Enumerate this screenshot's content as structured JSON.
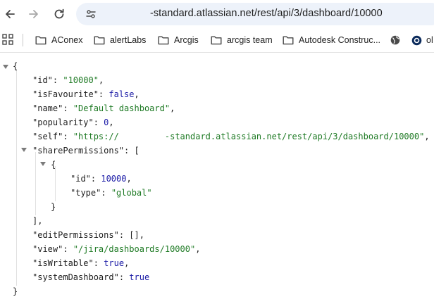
{
  "browser": {
    "url_visible": "-standard.atlassian.net/rest/api/3/dashboard/10000",
    "bookmarks": [
      {
        "label": "AConex",
        "icon": "folder-icon"
      },
      {
        "label": "alertLabs",
        "icon": "folder-icon"
      },
      {
        "label": "Arcgis",
        "icon": "folder-icon"
      },
      {
        "label": "arcgis team",
        "icon": "folder-icon"
      },
      {
        "label": "Autodesk Construc...",
        "icon": "folder-icon"
      },
      {
        "label": "ol",
        "icon": "profile-icon"
      }
    ]
  },
  "json": {
    "open_brace": "{",
    "close_brace": "}",
    "lines": [
      {
        "key": "\"id\"",
        "sep": ": ",
        "value": "\"10000\"",
        "value_type": "string",
        "tail": ","
      },
      {
        "key": "\"isFavourite\"",
        "sep": ": ",
        "value": "false",
        "value_type": "bool",
        "tail": ","
      },
      {
        "key": "\"name\"",
        "sep": ": ",
        "value": "\"Default dashboard\"",
        "value_type": "string",
        "tail": ","
      },
      {
        "key": "\"popularity\"",
        "sep": ": ",
        "value": "0",
        "value_type": "number",
        "tail": ","
      },
      {
        "key": "\"self\"",
        "sep": ": ",
        "value_a": "\"https://",
        "value_b": "-standard.atlassian.net/rest/api/3/dashboard/10000\"",
        "value_type": "string",
        "tail": ","
      },
      {
        "key": "\"sharePermissions\"",
        "sep": ": ",
        "value": "[",
        "value_type": "punct",
        "tail": ""
      },
      {
        "key": "\"editPermissions\"",
        "sep": ": ",
        "value": "[]",
        "value_type": "punct",
        "tail": ","
      },
      {
        "key": "\"view\"",
        "sep": ": ",
        "value": "\"/jira/dashboards/10000\"",
        "value_type": "string",
        "tail": ","
      },
      {
        "key": "\"isWritable\"",
        "sep": ": ",
        "value": "true",
        "value_type": "bool",
        "tail": ","
      },
      {
        "key": "\"systemDashboard\"",
        "sep": ": ",
        "value": "true",
        "value_type": "bool",
        "tail": ""
      }
    ],
    "share_item": {
      "open": "{",
      "close": "}",
      "id_key": "\"id\"",
      "id_value": "10000",
      "type_key": "\"type\"",
      "type_value": "\"global\""
    },
    "array_close": "],"
  }
}
